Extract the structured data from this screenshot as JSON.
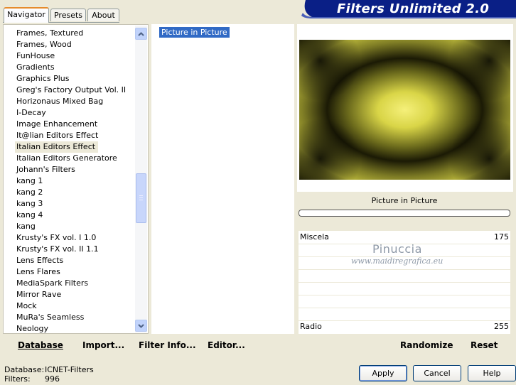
{
  "banner": {
    "title": "Filters Unlimited 2.0"
  },
  "tabs": [
    {
      "label": "Navigator",
      "active": true
    },
    {
      "label": "Presets",
      "active": false
    },
    {
      "label": "About",
      "active": false
    }
  ],
  "categories": [
    "Frames, Textured",
    "Frames, Wood",
    "FunHouse",
    "Gradients",
    "Graphics Plus",
    "Greg's Factory Output Vol. II",
    "Horizonaus Mixed Bag",
    "I-Decay",
    "Image Enhancement",
    "It@lian Editors Effect",
    "Italian Editors Effect",
    "Italian Editors Generatore",
    "Johann's Filters",
    "kang 1",
    "kang 2",
    "kang 3",
    "kang 4",
    "kang",
    "Krusty's FX vol. I 1.0",
    "Krusty's FX vol. II 1.1",
    "Lens Effects",
    "Lens Flares",
    "MediaSpark Filters",
    "Mirror Rave",
    "Mock",
    "MuRa's Seamless",
    "Neology"
  ],
  "selected_category_index": 10,
  "filters": [
    "Picture in Picture"
  ],
  "filter_name": "Picture in Picture",
  "params": [
    {
      "label": "Miscela",
      "value": "175"
    },
    {
      "label": "Radio",
      "value": "255"
    }
  ],
  "watermark": {
    "line1": "Pinuccia",
    "line2": "www.maidiregrafica.eu"
  },
  "bottom_links": {
    "database": "Database",
    "import": "Import...",
    "filter_info": "Filter Info...",
    "editor": "Editor...",
    "randomize": "Randomize",
    "reset": "Reset"
  },
  "status": {
    "database_label": "Database:",
    "database_value": "ICNET-Filters",
    "filters_label": "Filters:",
    "filters_value": "996"
  },
  "buttons": {
    "apply": "Apply",
    "cancel": "Cancel",
    "help": "Help"
  },
  "colors": {
    "selection": "#316ac5",
    "banner": "#0a1f86",
    "panel_bg": "#ece9d8"
  }
}
